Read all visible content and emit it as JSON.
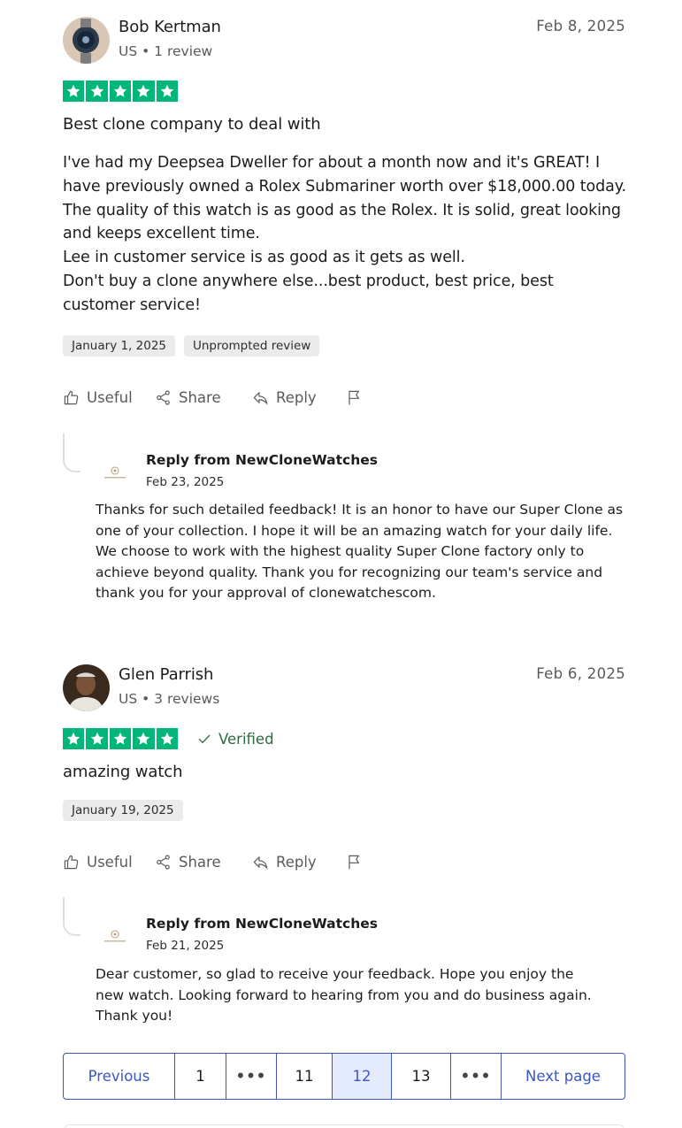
{
  "reviews": [
    {
      "author": "Bob Kertman",
      "meta": "US • 1 review",
      "date": "Feb 8, 2025",
      "rating": 5,
      "title": "Best clone company to deal with",
      "body": "I've had my Deepsea Dweller for about a month now and it's GREAT! I have previously owned a Rolex Submariner worth over $18,000.00 today. The quality of this watch is as good as the Rolex. It is solid, great looking and keeps excellent time.\nLee in customer service is as good as it gets as well.\nDon't buy a clone anywhere else...best product, best price, best customer service!",
      "chips": [
        "January 1, 2025",
        "Unprompted review"
      ],
      "actions": {
        "useful": "Useful",
        "share": "Share",
        "reply": "Reply"
      },
      "reply": {
        "from": "Reply from NewCloneWatches",
        "date": "Feb 23, 2025",
        "text": "Thanks for such detailed feedback! It is an honor to have our Super Clone as one of your collection. I hope it will be an amazing watch for your daily life. We choose to work with the highest quality Super Clone factory only to achieve beyond quality. Thank you for recognizing our team's service and thank you for your approval of clonewatchescom."
      }
    },
    {
      "author": "Glen Parrish",
      "meta": "US • 3 reviews",
      "date": "Feb 6, 2025",
      "rating": 5,
      "verified": "Verified",
      "title": "amazing watch",
      "chips": [
        "January 19, 2025"
      ],
      "actions": {
        "useful": "Useful",
        "share": "Share",
        "reply": "Reply"
      },
      "reply": {
        "from": "Reply from NewCloneWatches",
        "date": "Feb 21, 2025",
        "text": "Dear customer, so glad to receive your feedback. Hope you enjoy the new watch. Looking forward to hearing from you and do business again. Thank you!"
      }
    }
  ],
  "pagination": {
    "previous": "Previous",
    "pages": [
      "1",
      "•••",
      "11",
      "12",
      "13",
      "•••"
    ],
    "current": "12",
    "next": "Next page"
  },
  "colors": {
    "star_green": "#00b67a",
    "link_blue": "#3c57bc",
    "active_page_bg": "#e5ebff",
    "verified_green": "#2c6a42"
  }
}
